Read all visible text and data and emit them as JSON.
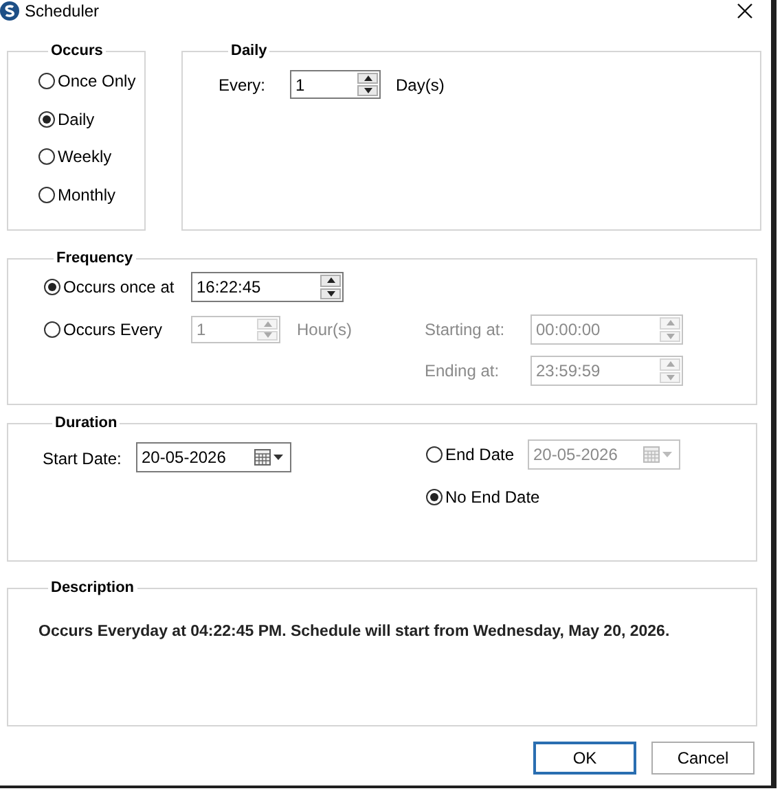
{
  "window": {
    "title": "Scheduler"
  },
  "occurs": {
    "title": "Occurs",
    "options": [
      {
        "label": "Once Only",
        "selected": false
      },
      {
        "label": "Daily",
        "selected": true
      },
      {
        "label": "Weekly",
        "selected": false
      },
      {
        "label": "Monthly",
        "selected": false
      }
    ]
  },
  "daily": {
    "title": "Daily",
    "every_label": "Every:",
    "every_value": "1",
    "unit": "Day(s)"
  },
  "frequency": {
    "title": "Frequency",
    "options": [
      {
        "label": "Occurs once at",
        "selected": true
      },
      {
        "label": "Occurs Every",
        "selected": false
      }
    ],
    "once_time": "16:22:45",
    "every_value": "1",
    "every_unit": "Hour(s)",
    "starting_label": "Starting at:",
    "starting_value": "00:00:00",
    "ending_label": "Ending at:",
    "ending_value": "23:59:59"
  },
  "duration": {
    "title": "Duration",
    "start_label": "Start Date:",
    "start_value": "20-05-2026",
    "end_options": [
      {
        "label": "End Date",
        "selected": false
      },
      {
        "label": "No End Date",
        "selected": true
      }
    ],
    "end_value": "20-05-2026"
  },
  "description": {
    "title": "Description",
    "text": "Occurs Everyday at 04:22:45 PM. Schedule will start from Wednesday, May 20, 2026."
  },
  "buttons": [
    {
      "label": "OK",
      "default": true
    },
    {
      "label": "Cancel",
      "default": false
    }
  ]
}
